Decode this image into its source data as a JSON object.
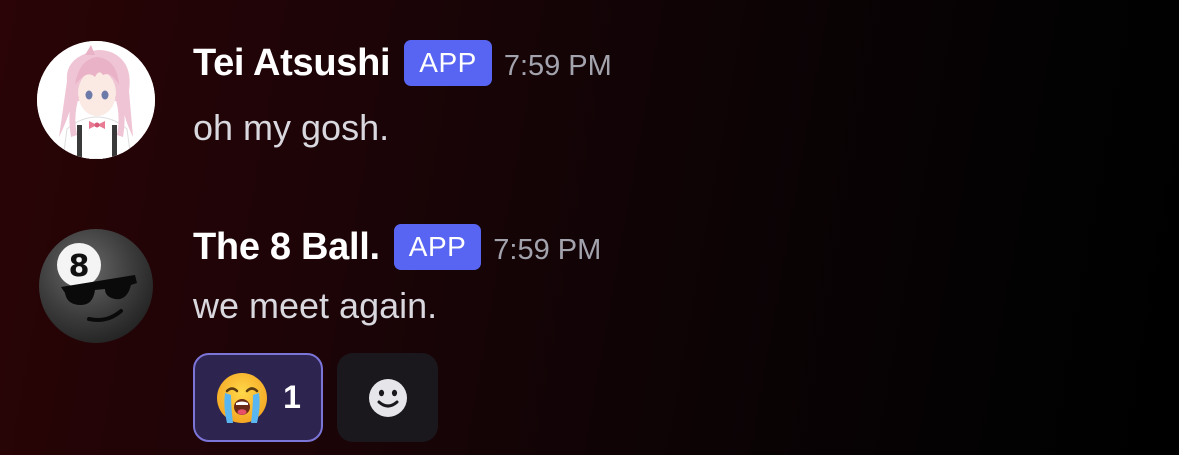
{
  "messages": [
    {
      "username": "Tei Atsushi",
      "badge": "APP",
      "timestamp": "7:59 PM",
      "text": "oh my gosh.",
      "avatar": "anime-character-avatar"
    },
    {
      "username": "The 8 Ball.",
      "badge": "APP",
      "timestamp": "7:59 PM",
      "text": "we meet again.",
      "avatar": "8-ball-sunglasses-avatar",
      "avatar_number": "8"
    }
  ],
  "reactions": [
    {
      "emoji": "loudly-crying-face-icon",
      "count": "1",
      "selected": true
    }
  ],
  "add_reaction": {
    "icon": "smiley-add-reaction-icon"
  },
  "colors": {
    "badge": "#5865f2",
    "reaction_selected_bg": "#2e2450",
    "reaction_selected_border": "#7c75d8",
    "timestamp": "#a3a3ad"
  }
}
